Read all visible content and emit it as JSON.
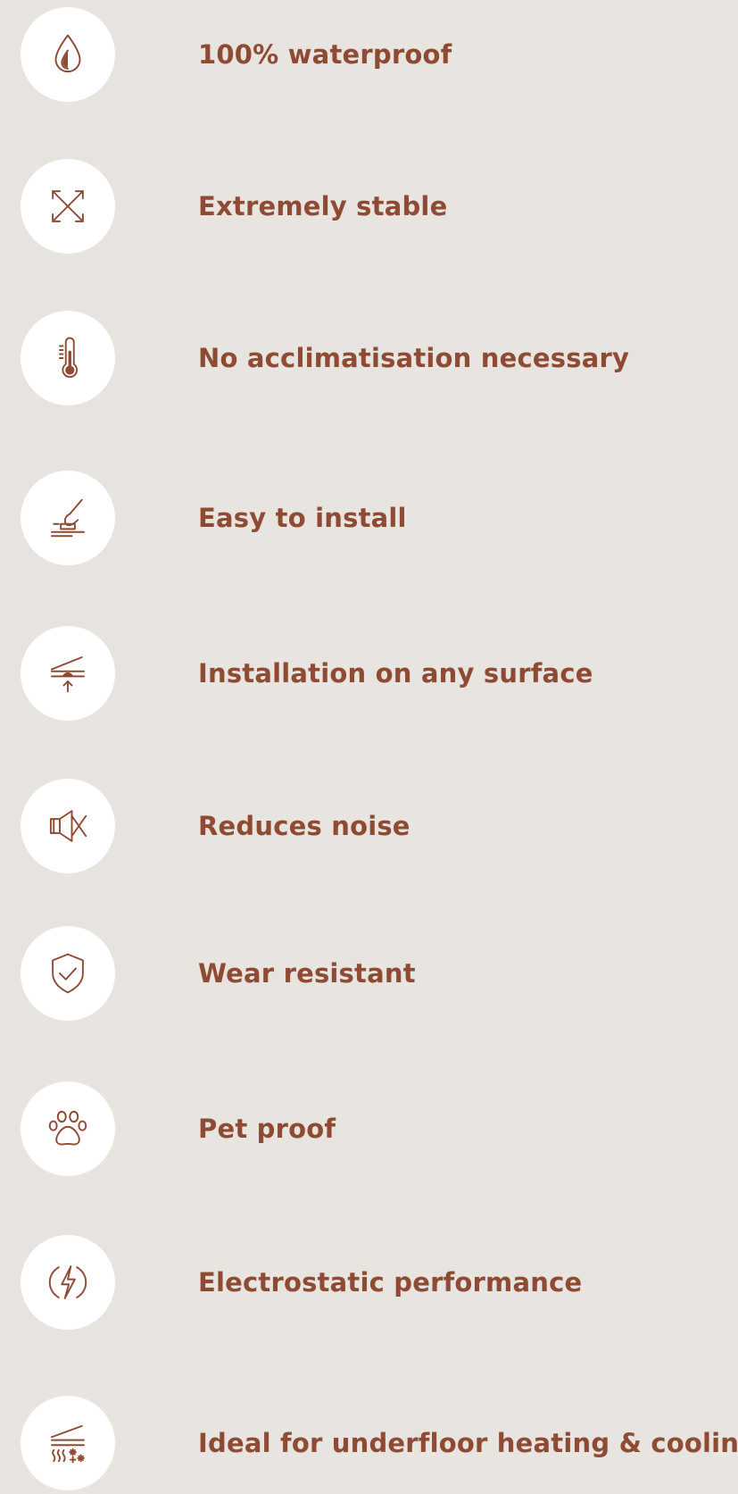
{
  "colors": {
    "background": "#e8e4df",
    "icon_circle": "#ffffff",
    "accent": "#8e4a33"
  },
  "features": [
    {
      "label": "100% waterproof",
      "icon": "water-drop-icon"
    },
    {
      "label": "Extremely stable",
      "icon": "expand-arrows-icon"
    },
    {
      "label": "No acclimatisation necessary",
      "icon": "thermometer-icon"
    },
    {
      "label": "Easy to install",
      "icon": "hand-install-icon"
    },
    {
      "label": "Installation on any surface",
      "icon": "floor-layers-arrow-icon"
    },
    {
      "label": "Reduces noise",
      "icon": "speaker-muted-icon"
    },
    {
      "label": "Wear resistant",
      "icon": "shield-check-icon"
    },
    {
      "label": "Pet proof",
      "icon": "paw-icon"
    },
    {
      "label": "Electrostatic performance",
      "icon": "lightning-circle-icon"
    },
    {
      "label": "Ideal for underfloor heating & cooling",
      "icon": "heating-cooling-icon"
    }
  ]
}
